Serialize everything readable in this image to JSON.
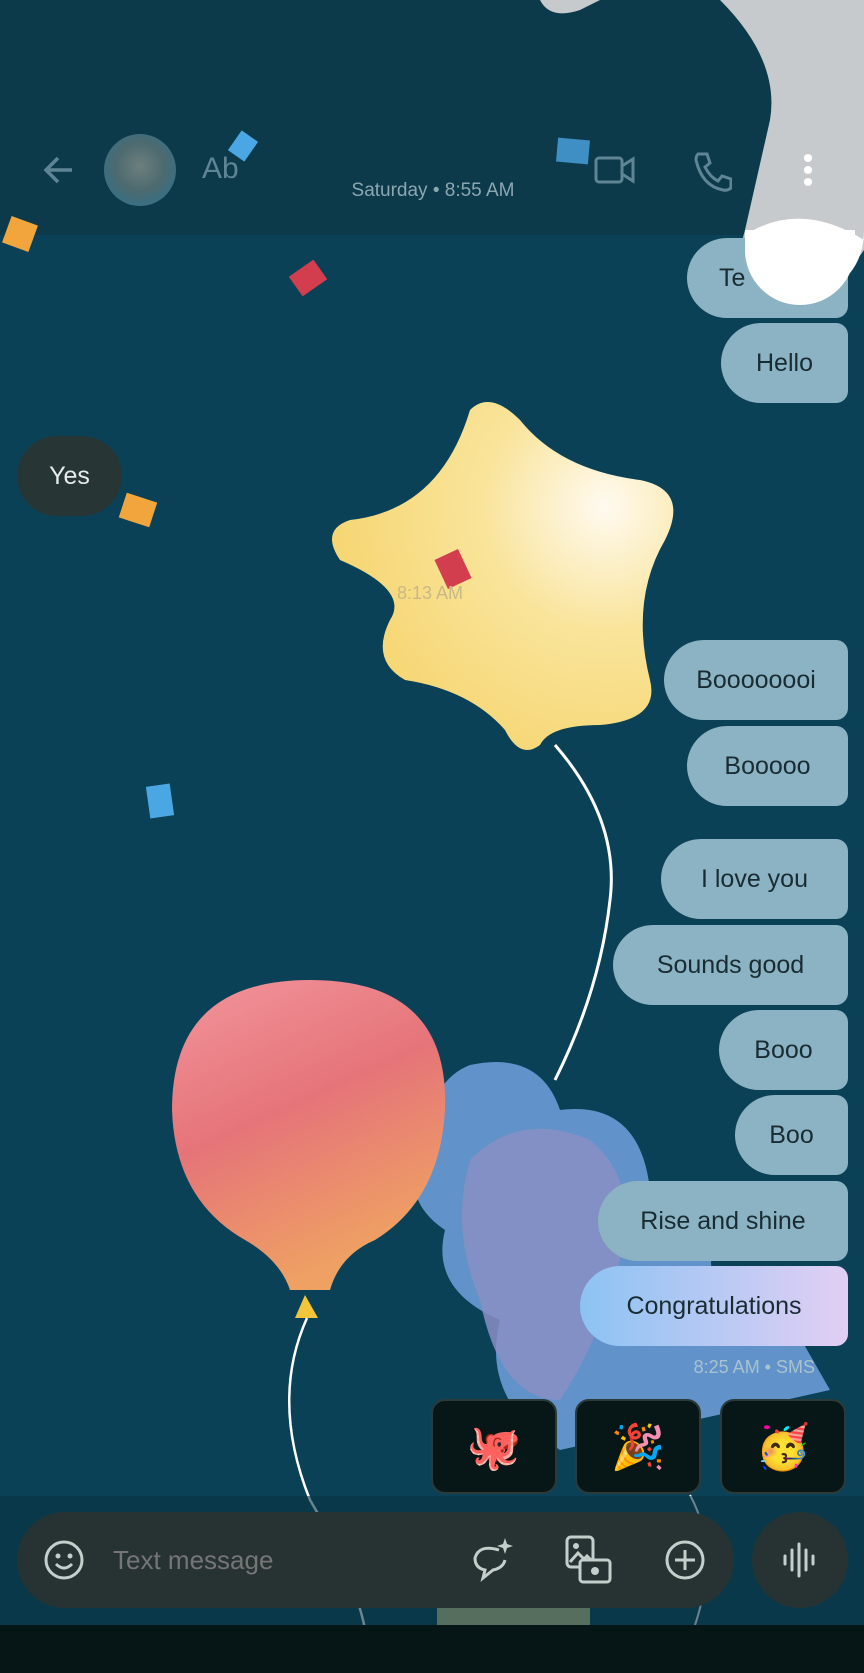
{
  "header": {
    "contact_initials": "Ab",
    "timestamp": "Saturday • 8:55 AM",
    "icons": [
      "back-arrow-icon",
      "avatar",
      "video-call-icon",
      "phone-icon",
      "more-vert-icon"
    ]
  },
  "messages": [
    {
      "text": "Te",
      "dir": "out"
    },
    {
      "text": "Hello",
      "dir": "out"
    },
    {
      "text": "Yes",
      "dir": "in"
    },
    {
      "text": "Boooooooi",
      "dir": "out"
    },
    {
      "text": "Booooo",
      "dir": "out"
    },
    {
      "text": "I love you",
      "dir": "out"
    },
    {
      "text": "Sounds good",
      "dir": "out"
    },
    {
      "text": "Booo",
      "dir": "out"
    },
    {
      "text": "Boo",
      "dir": "out"
    },
    {
      "text": "Rise and shine",
      "dir": "out"
    },
    {
      "text": "Congratulations",
      "dir": "out"
    }
  ],
  "timestamps": {
    "mid": "8:13 AM",
    "last": "8:25 AM • SMS"
  },
  "stickers": [
    {
      "name": "party-octopus-sticker",
      "glyph": "🐙"
    },
    {
      "name": "party-popper-sticker",
      "glyph": "🎉"
    },
    {
      "name": "partying-face-sticker",
      "glyph": "🥳"
    }
  ],
  "compose": {
    "placeholder": "Text message"
  },
  "colors": {
    "background": "#0a4157",
    "bubble_out": "#8bb3c3",
    "bubble_in": "#273634",
    "compose": "#263332"
  }
}
